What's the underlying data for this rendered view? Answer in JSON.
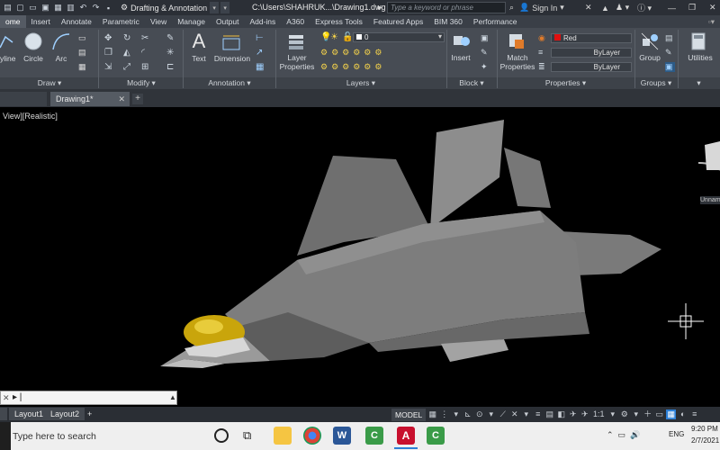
{
  "titlebar": {
    "workspace": "Drafting & Annotation",
    "file_path": "C:\\Users\\SHAHRUK...\\Drawing1.dwg",
    "search_placeholder": "Type a keyword or phrase",
    "sign_in": "Sign In"
  },
  "ribbon_tabs": [
    "ome",
    "Insert",
    "Annotate",
    "Parametric",
    "View",
    "Manage",
    "Output",
    "Add-ins",
    "A360",
    "Express Tools",
    "Featured Apps",
    "BIM 360",
    "Performance"
  ],
  "ribbon": {
    "draw_tools": [
      "yline",
      "Circle",
      "Arc"
    ],
    "panel_labels": {
      "draw": "Draw ▾",
      "modify": "Modify ▾",
      "annotation": "Annotation ▾",
      "layers": "Layers ▾",
      "block": "Block ▾",
      "properties": "Properties ▾",
      "groups": "Groups ▾"
    },
    "text_tool": "Text",
    "dimension_tool": "Dimension",
    "layer_properties": [
      "Layer",
      "Properties"
    ],
    "insert_tool": "Insert",
    "match_properties": [
      "Match",
      "Properties"
    ],
    "layer_dropdown_value": "0",
    "color_value": "Red",
    "linetype_value": "ByLayer",
    "lineweight_value": "ByLayer",
    "group_tool": "Group",
    "utilities_tool": "Utilities",
    "accent_color": "#e01010"
  },
  "file_tabs": {
    "active": "Drawing1*",
    "new_tab": "+"
  },
  "viewport": {
    "label": "View][Realistic]",
    "viewcube_label": "Unnam"
  },
  "command_line": {
    "prefix": "✕",
    "caret": "▸ |"
  },
  "layout_tabs": [
    "Layout1",
    "Layout2"
  ],
  "statusbar": {
    "model": "MODEL",
    "scale": "1:1"
  },
  "taskbar": {
    "search_text": "Type here to search",
    "time": "9:20 PM",
    "date": "2/7/2021",
    "language": "ENG"
  }
}
